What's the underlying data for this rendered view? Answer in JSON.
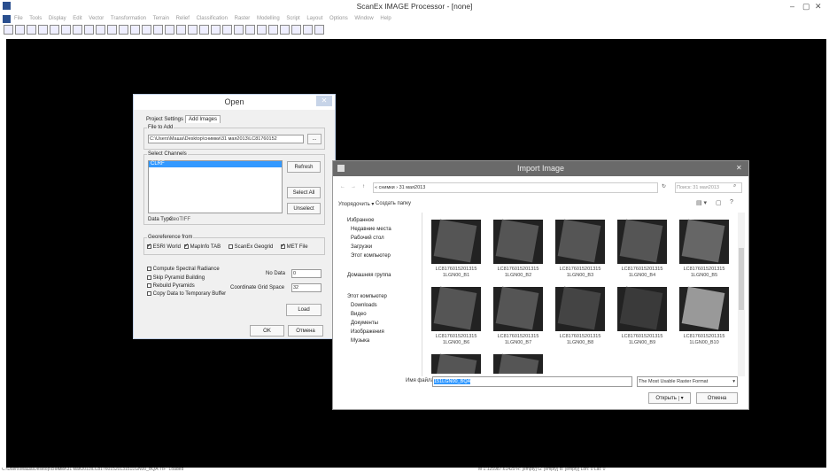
{
  "window": {
    "title": "ScanEx IMAGE Processor - [none]",
    "controls": [
      "–",
      "▢",
      "✕"
    ]
  },
  "menu": [
    "File",
    "Tools",
    "Display",
    "Edit",
    "Vector",
    "Transformation",
    "Terrain",
    "Relief",
    "Classification",
    "Raster",
    "Modelling",
    "Script",
    "Layout",
    "Options",
    "Window",
    "Help"
  ],
  "open_dialog": {
    "title": "Open",
    "tabs": [
      "Project Settings",
      "Add Images"
    ],
    "file_to_add_label": "File to Add",
    "file_path": "C:\\Users\\Маша\\Desktop\\снимки\\31 мая2013\\LC81760152",
    "browse_label": "...",
    "select_channels_label": "Select Channels",
    "channel_item": "CLRF",
    "refresh": "Refresh",
    "select_all": "Select All",
    "unselect": "Unselect",
    "data_type_label": "Data Type:",
    "data_type_value": "GeoTIFF",
    "georef_label": "Georeference from",
    "georef_esri": "ESRI World",
    "georef_mapinfo": "MapInfo TAB",
    "georef_scanex": "ScanEx Geogrid",
    "georef_met": "MET File",
    "compute_radiance": "Compute Spectral Radiance",
    "skip_pyramid": "Skip Pyramid Building",
    "rebuild_pyramids": "Rebuild Pyramids",
    "copy_temp": "Copy Data to Temporary Buffer",
    "nodata_label": "No Data",
    "nodata_value": "0",
    "grid_space_label": "Coordinate Grid Space",
    "grid_space_value": "32",
    "load": "Load",
    "ok": "OK",
    "cancel": "Отмена"
  },
  "import_dialog": {
    "title": "Import Image",
    "breadcrumb": "« снимки › 31 мая2013",
    "search_placeholder": "Поиск: 31 мая2013",
    "organize": "Упорядочить ▾",
    "new_folder": "Создать папку",
    "nav": [
      "Избранное",
      "Недавние места",
      "Рабочий стол",
      "Загрузки",
      "Этот компьютер",
      "Домашняя группа",
      "Этот компьютер",
      "Downloads",
      "Видео",
      "Документы",
      "Изображения",
      "Музыка"
    ],
    "files": [
      {
        "line1": "LC8176015201315",
        "line2": "1LGN00_B1"
      },
      {
        "line1": "LC8176015201315",
        "line2": "1LGN00_B2"
      },
      {
        "line1": "LC8176015201315",
        "line2": "1LGN00_B3"
      },
      {
        "line1": "LC8176015201315",
        "line2": "1LGN00_B4"
      },
      {
        "line1": "LC8176015201315",
        "line2": "1LGN00_B5"
      },
      {
        "line1": "LC8176015201315",
        "line2": "1LGN00_B6"
      },
      {
        "line1": "LC8176015201315",
        "line2": "1LGN00_B7"
      },
      {
        "line1": "LC8176015201315",
        "line2": "1LGN00_B8"
      },
      {
        "line1": "LC8176015201315",
        "line2": "1LGN00_B9"
      },
      {
        "line1": "LC8176015201315",
        "line2": "1LGN00_B10"
      }
    ],
    "filename_label": "Имя файла:",
    "filename_value": "151LGN00_BQA",
    "filter": "The Most Usable Raster Format",
    "open": "Открыть",
    "cancel": "Отмена"
  },
  "status": {
    "left": "C:\\Users\\Маша\\Desktop\\снимки\\31 мая2013\\LC81760152013151LGN00_BQA.TIF\" Loaded",
    "right": "M 1:125987.61429   R: [empty]   G: [empty]   B: [empty]   Lon: 0        Lat: 0"
  },
  "colors": {
    "canvas": "#000000",
    "import_title": "#6a6a6a",
    "selection": "#3399ff"
  }
}
